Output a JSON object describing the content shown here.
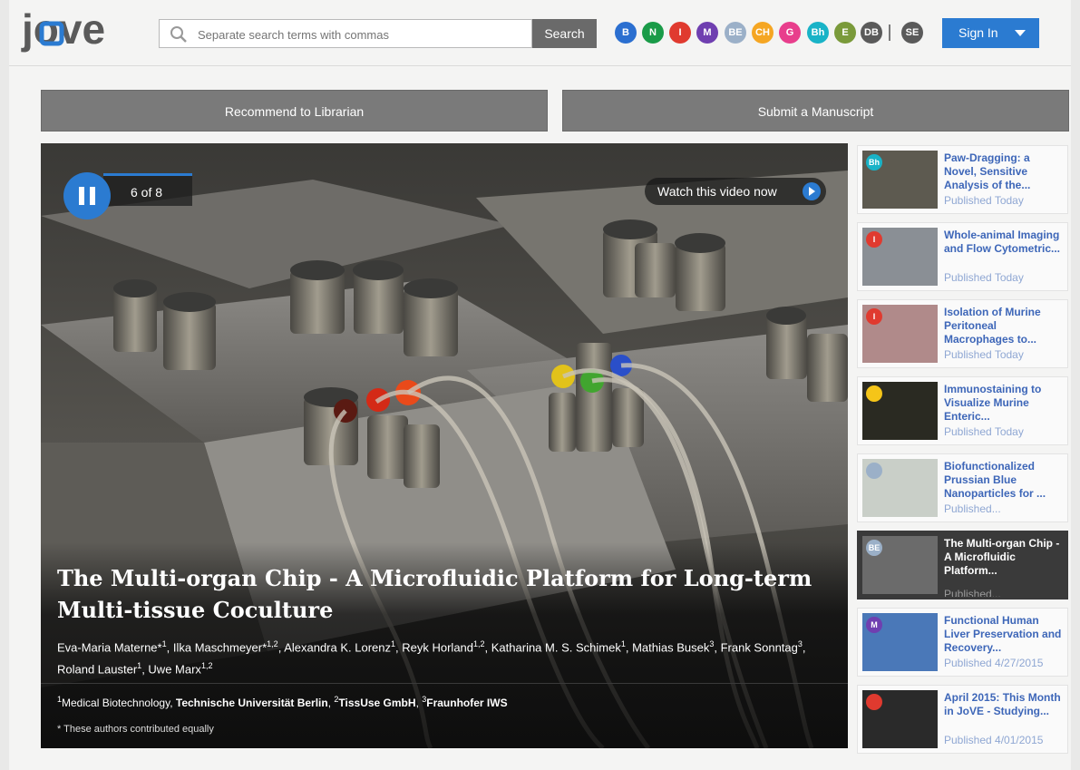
{
  "header": {
    "logo_text": "jove",
    "search_placeholder": "Separate search terms with commas",
    "search_button": "Search",
    "sections": [
      {
        "label": "B",
        "color": "#2b6fd0"
      },
      {
        "label": "N",
        "color": "#1a9b48"
      },
      {
        "label": "I",
        "color": "#e03a2f"
      },
      {
        "label": "M",
        "color": "#6f3fb0"
      },
      {
        "label": "BE",
        "color": "#9bb0c8"
      },
      {
        "label": "CH",
        "color": "#f5a623"
      },
      {
        "label": "G",
        "color": "#e83e8c"
      },
      {
        "label": "Bh",
        "color": "#19b3c7"
      },
      {
        "label": "E",
        "color": "#7a9a3a"
      },
      {
        "label": "DB",
        "color": "#5a5a5a"
      },
      {
        "label": "SE",
        "color": "#5a5a5a"
      }
    ],
    "sign_in": "Sign In"
  },
  "actions": {
    "recommend": "Recommend to Librarian",
    "submit": "Submit a Manuscript"
  },
  "hero": {
    "counter": "6 of 8",
    "watch_label": "Watch this video now",
    "title": "The Multi-organ Chip - A Microfluidic Platform for Long-term Multi-tissue Coculture",
    "authors": [
      {
        "name": "Eva-Maria Materne*",
        "sup": "1"
      },
      {
        "name": "Ilka Maschmeyer*",
        "sup": "1,2"
      },
      {
        "name": "Alexandra K. Lorenz",
        "sup": "1"
      },
      {
        "name": "Reyk Horland",
        "sup": "1,2"
      },
      {
        "name": "Katharina M. S. Schimek",
        "sup": "1"
      },
      {
        "name": "Mathias Busek",
        "sup": "3"
      },
      {
        "name": "Frank Sonntag",
        "sup": "3"
      },
      {
        "name": "Roland Lauster",
        "sup": "1"
      },
      {
        "name": "Uwe Marx",
        "sup": "1,2"
      }
    ],
    "affiliations": [
      {
        "sup": "1",
        "dept": "Medical Biotechnology, ",
        "org": "Technische Universität Berlin"
      },
      {
        "sup": "2",
        "dept": "",
        "org": "TissUse GmbH"
      },
      {
        "sup": "3",
        "dept": "",
        "org": "Fraunhofer IWS"
      }
    ],
    "note": "* These authors contributed equally"
  },
  "sidebar": {
    "items": [
      {
        "title": "Paw-Dragging: a Novel, Sensitive Analysis of the...",
        "date": "Published Today",
        "badge": "Bh",
        "badge_color": "#19b3c7",
        "thumb_color": "#5d5a50",
        "active": false
      },
      {
        "title": "Whole-animal Imaging and Flow Cytometric...",
        "date": "Published Today",
        "badge": "I",
        "badge_color": "#e03a2f",
        "thumb_color": "#8a8f95",
        "active": false
      },
      {
        "title": "Isolation of Murine Peritoneal Macrophages to...",
        "date": "Published Today",
        "badge": "I",
        "badge_color": "#e03a2f",
        "thumb_color": "#b08a8a",
        "active": false
      },
      {
        "title": "Immunostaining to Visualize Murine Enteric...",
        "date": "Published Today",
        "badge": "",
        "badge_color": "#f5c518",
        "thumb_color": "#2a2a22",
        "active": false
      },
      {
        "title": "Biofunctionalized Prussian Blue Nanoparticles for ...",
        "date": "Published...",
        "badge": "",
        "badge_color": "#9bb0c8",
        "thumb_color": "#c9cfc8",
        "active": false
      },
      {
        "title": "The Multi-organ Chip - A Microfluidic Platform...",
        "date": "Published...",
        "badge": "BE",
        "badge_color": "#9bb0c8",
        "thumb_color": "#6b6b6b",
        "active": true
      },
      {
        "title": "Functional Human Liver Preservation and Recovery...",
        "date": "Published 4/27/2015",
        "badge": "M",
        "badge_color": "#6f3fb0",
        "thumb_color": "#4a78b8",
        "active": false
      },
      {
        "title": "April 2015: This Month in JoVE - Studying...",
        "date": "Published 4/01/2015",
        "badge": "",
        "badge_color": "#e03a2f",
        "thumb_color": "#2a2a2a",
        "active": false
      }
    ]
  }
}
